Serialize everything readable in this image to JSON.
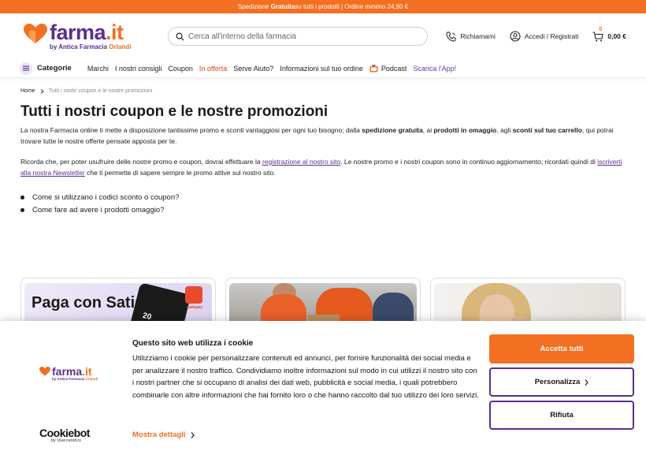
{
  "promo_bar": {
    "prefix": "Spedizione ",
    "bold": "Gratuita",
    "suffix": " su tutti i prodotti | Ordine minimo 24,90 €"
  },
  "header": {
    "logo_word": "farma",
    "logo_dot": ".it",
    "logo_sub_prefix": "by ",
    "logo_sub_brand": "Antica Farmacia",
    "logo_sub_name": " Orlandi",
    "search_placeholder": "Cerca all'interno della farmacia",
    "callback": "Richiamami",
    "login": "Accedi / Registrati",
    "cart_count": "0",
    "cart_total": "0,00 €"
  },
  "nav": {
    "categories": "Categorie",
    "items": [
      "Marchi",
      "I nostri consigli",
      "Coupon",
      "In offerta",
      "Serve Aiuto?",
      "Informazioni sul tuo ordine"
    ],
    "podcast": "Podcast",
    "app": "Scarica l'App!"
  },
  "breadcrumb": {
    "home": "Home",
    "current": "Tutti i nostri coupon e le nostre promozioni"
  },
  "page": {
    "title": "Tutti i nostri coupon e le nostre promozioni",
    "p1_a": "La nostra Farmacia online ti mette a disposizione tantissime promo e sconti vantaggiosi per ogni tuo bisogno; dalla ",
    "p1_b": "spedizione gratuita",
    "p1_c": ", ai ",
    "p1_d": "prodotti in omaggio",
    "p1_e": ", agli ",
    "p1_f": "sconti sul tuo carrello",
    "p1_g": ", qui potrai trovare tutte le nostre offerte pensate apposta per te.",
    "p2_a": "Ricorda che, per poter usufruire delle nostre promo e coupon, dovrai effettuare la ",
    "p2_link1": "registrazione al nostro sito",
    "p2_b": ". Le nostre promo e i nostri coupon sono in continuo aggiornamento; ricordati quindi di ",
    "p2_link2": "iscriverti alla nostra Newsletter",
    "p2_c": " che ti permette di sapere sempre le promo attive sul nostro sito.",
    "faq": [
      "Come si utilizzano i codici sconto o coupon?",
      "Come fare ad avere i prodotti omaggio?"
    ]
  },
  "cards": {
    "card1_title": "Paga con Satispay!",
    "card1_amount": "20",
    "card1_brand": "satispay"
  },
  "cookie": {
    "title": "Questo sito web utilizza i cookie",
    "text": "Utilizziamo i cookie per personalizzare contenuti ed annunci, per fornire funzionalità dei social media e per analizzare il nostro traffico. Condividiamo inoltre informazioni sul modo in cui utilizzi il nostro sito con i nostri partner che si occupano di analisi dei dati web, pubblicità e social media, i quali potrebbero combinarle con altre informazioni che hai fornito loro o che hanno raccolto dal tuo utilizzo dei loro servizi.",
    "details": "Mostra dettagli",
    "accept": "Accetta tutti",
    "customize": "Personalizza",
    "reject": "Rifiuta",
    "cookiebot": "Cookiebot",
    "cookiebot_sub": "by Usercentrics"
  },
  "colors": {
    "brand_orange": "#f36f21",
    "brand_purple": "#5b2d8e",
    "sale_red": "#e8420c"
  },
  "icons": [
    "search-icon",
    "phone-icon",
    "user-icon",
    "cart-icon",
    "menu-icon",
    "chevron-right-icon",
    "podcast-icon",
    "heart-logo-icon"
  ]
}
